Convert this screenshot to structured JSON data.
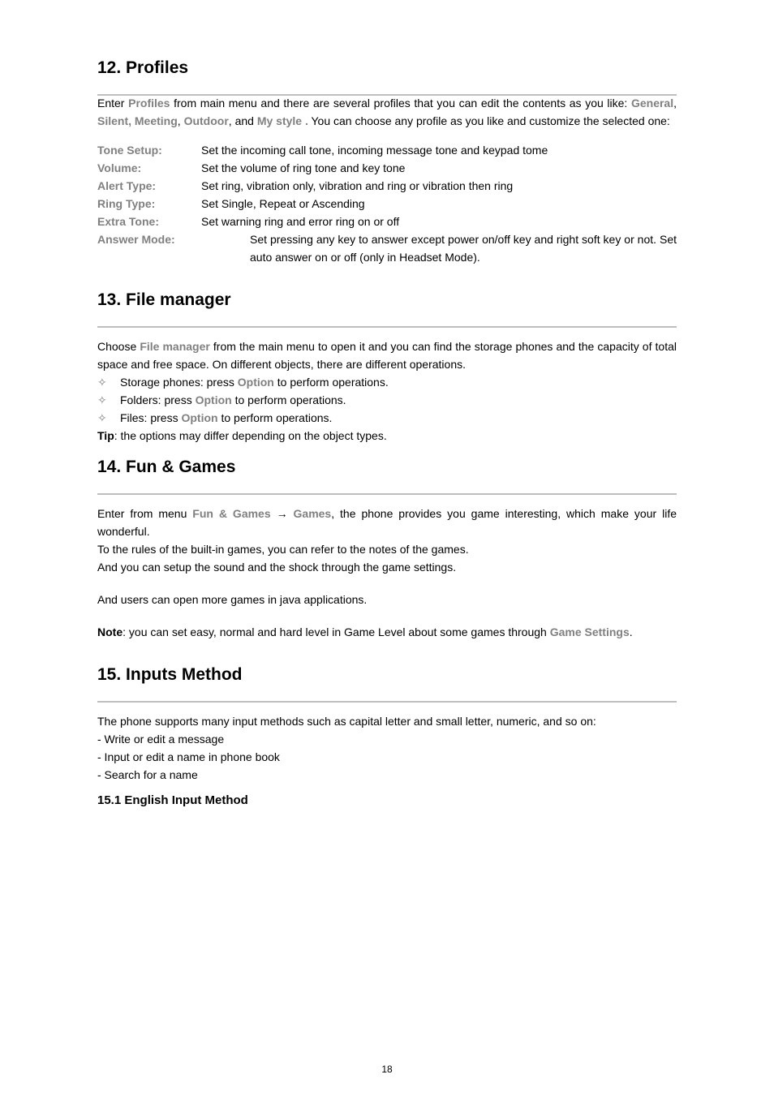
{
  "section12": {
    "title": "12. Profiles",
    "intro_part1": "Enter ",
    "kw_profiles": "Profiles",
    "intro_part2": " from main menu and there are several profiles that you can edit the contents as you like: ",
    "kw_general": "General",
    "sep1": ", ",
    "kw_silent_meeting": "Silent, Meeting",
    "sep2": ", ",
    "kw_outdoor": "Outdoor",
    "sep3": ", and ",
    "kw_mystyle": "My style .",
    "intro_part3": " You can choose any profile as you like and customize the selected one:",
    "rows": [
      {
        "label": "Tone Setup:",
        "value": "Set the incoming call tone, incoming message tone and keypad tome"
      },
      {
        "label": "Volume:",
        "value": "Set the volume of ring tone and key tone"
      },
      {
        "label": "Alert Type:",
        "value": "Set ring, vibration only, vibration and ring or vibration then ring"
      },
      {
        "label": "Ring Type:",
        "value": "Set Single, Repeat or Ascending"
      },
      {
        "label": "Extra Tone:",
        "value": "Set warning ring and error ring on or off"
      }
    ],
    "answer_label": "Answer Mode:",
    "answer_value": "Set pressing any key to answer except power on/off key and right soft key or not. Set auto answer on or off (only in Headset Mode)."
  },
  "section13": {
    "title": "13. File manager",
    "para_part1": "Choose ",
    "kw_fm": "File manager",
    "para_part2": " from the main menu to open it and you can find the storage phones and the capacity of total space and free space. On different objects, there are different operations.",
    "bullets": [
      {
        "pre": "Storage phones: press ",
        "kw": "Option",
        "post": " to perform operations."
      },
      {
        "pre": "Folders: press ",
        "kw": "Option",
        "post": " to perform operations."
      },
      {
        "pre": "Files: press ",
        "kw": "Option",
        "post": " to perform operations."
      }
    ],
    "tip_b": "Tip",
    "tip_rest": ": the options may differ depending on the object types."
  },
  "section14": {
    "title": "14. Fun & Games",
    "p1_1": "Enter from menu ",
    "kw_fun": "Fun & Games",
    "arrow": " → ",
    "kw_games": "Games",
    "p1_2": ", the phone provides you game interesting, which make your life wonderful.",
    "p2": "To the rules of the built-in games, you can refer to the notes of the games.",
    "p3": "And you can setup the sound and the shock through the game settings.",
    "p4": "And users can open more games in java applications.",
    "note_b": "Note",
    "note_rest": ": you can set easy, normal and hard level in Game Level about some games through ",
    "kw_gs": "Game Settings",
    "note_tail": "."
  },
  "section15": {
    "title": "15. Inputs Method",
    "p1": "The phone supports many input methods such as capital letter and small letter, numeric, and so on:",
    "l1": "- Write or edit a message",
    "l2": "- Input or edit a name in phone book",
    "l3": "- Search for a name",
    "sub": "15.1 English Input Method"
  },
  "page_number": "18"
}
